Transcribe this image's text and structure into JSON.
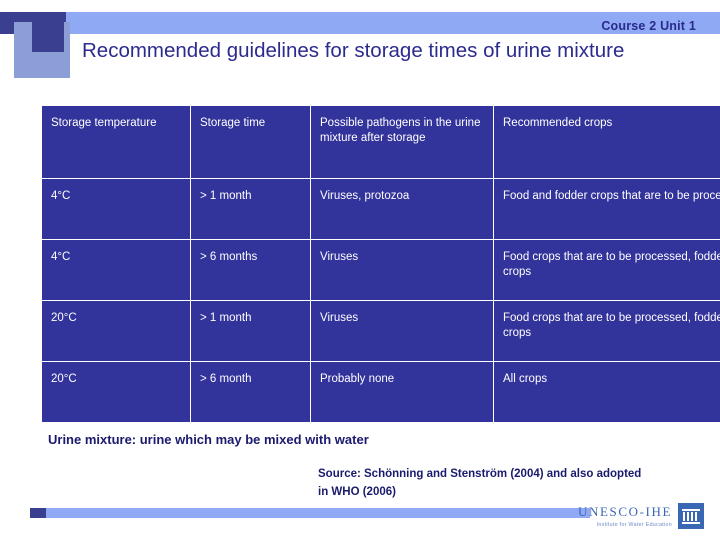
{
  "header": {
    "course_label": "Course 2 Unit 1",
    "title": "Recommended guidelines for storage times of urine mixture"
  },
  "table": {
    "columns": [
      "Storage temperature",
      "Storage time",
      "Possible pathogens in the urine mixture after storage",
      "Recommended crops"
    ],
    "rows": [
      {
        "temperature": "4°C",
        "time": "> 1 month",
        "pathogens": "Viruses, protozoa",
        "crops": "Food and fodder crops that are to be processed"
      },
      {
        "temperature": "4°C",
        "time": "> 6 months",
        "pathogens": "Viruses",
        "crops": "Food crops that are to be processed, fodder crops"
      },
      {
        "temperature": "20°C",
        "time": "> 1 month",
        "pathogens": "Viruses",
        "crops": "Food crops that are to be processed, fodder crops"
      },
      {
        "temperature": "20°C",
        "time": "> 6 month",
        "pathogens": "Probably none",
        "crops": "All crops"
      }
    ]
  },
  "footnote": "Urine mixture: urine which may be mixed with water",
  "source": "Source: Schönning and Stenström (2004) and also adopted in WHO (2006)",
  "logo": {
    "name": "UNESCO-IHE",
    "subtitle": "Institute for Water Education"
  },
  "colors": {
    "table_bg": "#33339c",
    "title": "#2b2b8f",
    "band": "#8fa9f4",
    "band_dark": "#3b3f8f",
    "logo": "#3a67b4"
  }
}
